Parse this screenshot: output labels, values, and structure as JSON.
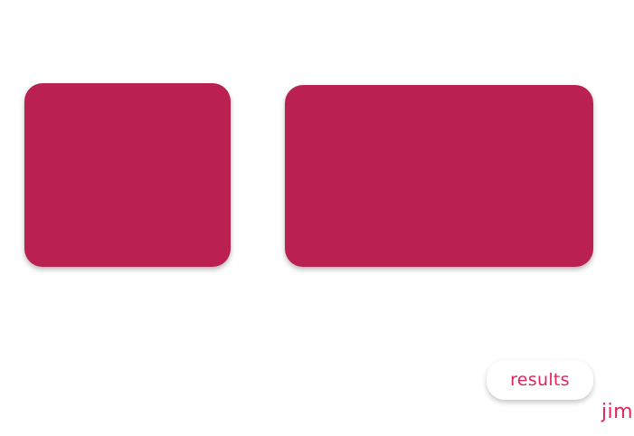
{
  "colors": {
    "card": "#bb2150",
    "accent": "#e0245e",
    "background": "#ffffff"
  },
  "cards": [
    {
      "label": ""
    },
    {
      "label": ""
    }
  ],
  "results_button": {
    "label": "results"
  },
  "user": {
    "name": "jim"
  }
}
